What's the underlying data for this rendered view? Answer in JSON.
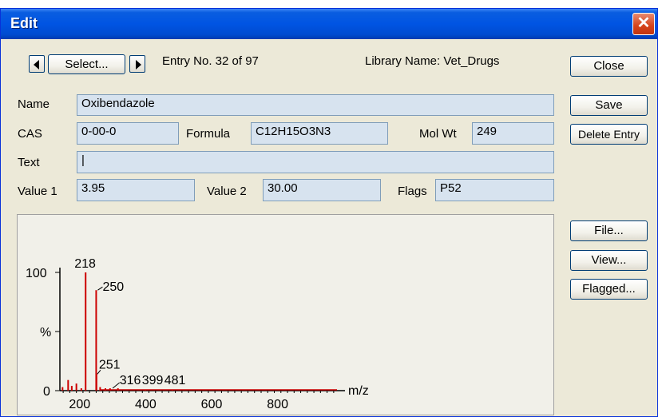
{
  "window": {
    "title": "Edit"
  },
  "nav": {
    "select_label": "Select...",
    "entry_text": "Entry No.  32 of 97",
    "library_text": "Library Name:  Vet_Drugs"
  },
  "buttons": {
    "close": "Close",
    "save": "Save",
    "delete": "Delete Entry",
    "file": "File...",
    "view": "View...",
    "flagged": "Flagged..."
  },
  "fields": {
    "name_label": "Name",
    "name_value": "Oxibendazole",
    "cas_label": "CAS",
    "cas_value": "0-00-0",
    "formula_label": "Formula",
    "formula_value": "C12H15O3N3",
    "molwt_label": "Mol Wt",
    "molwt_value": "249",
    "text_label": "Text",
    "text_value": "|",
    "value1_label": "Value 1",
    "value1_value": "3.95",
    "value2_label": "Value 2",
    "value2_value": "30.00",
    "flags_label": "Flags",
    "flags_value": "P52"
  },
  "colors": {
    "title_bar": "#0054e3",
    "field_bg": "#d7e3ef",
    "spectrum_line": "#cc0000",
    "dialog_bg": "#ece9d8"
  },
  "chart_data": {
    "type": "bar",
    "xlabel": "m/z",
    "ylabel": "%",
    "xlim": [
      140,
      980
    ],
    "ylim": [
      0,
      100
    ],
    "x_ticks": [
      "200",
      "400",
      "600",
      "800"
    ],
    "y_ticks": [
      "100",
      "%",
      "0"
    ],
    "peaks": [
      {
        "mz": 148,
        "intensity": 3
      },
      {
        "mz": 165,
        "intensity": 9
      },
      {
        "mz": 176,
        "intensity": 4
      },
      {
        "mz": 190,
        "intensity": 6
      },
      {
        "mz": 205,
        "intensity": 2
      },
      {
        "mz": 218,
        "intensity": 100
      },
      {
        "mz": 250,
        "intensity": 85
      },
      {
        "mz": 251,
        "intensity": 14
      },
      {
        "mz": 262,
        "intensity": 3
      },
      {
        "mz": 278,
        "intensity": 2
      },
      {
        "mz": 292,
        "intensity": 2
      },
      {
        "mz": 316,
        "intensity": 2
      },
      {
        "mz": 399,
        "intensity": 1
      },
      {
        "mz": 481,
        "intensity": 1
      }
    ],
    "peak_labels": [
      {
        "mz": 218,
        "text": "218"
      },
      {
        "mz": 250,
        "text": "250"
      },
      {
        "mz": 251,
        "text": "251"
      },
      {
        "mz": 316,
        "text": "316"
      },
      {
        "mz": 399,
        "text": "399"
      },
      {
        "mz": 481,
        "text": "481"
      }
    ]
  }
}
